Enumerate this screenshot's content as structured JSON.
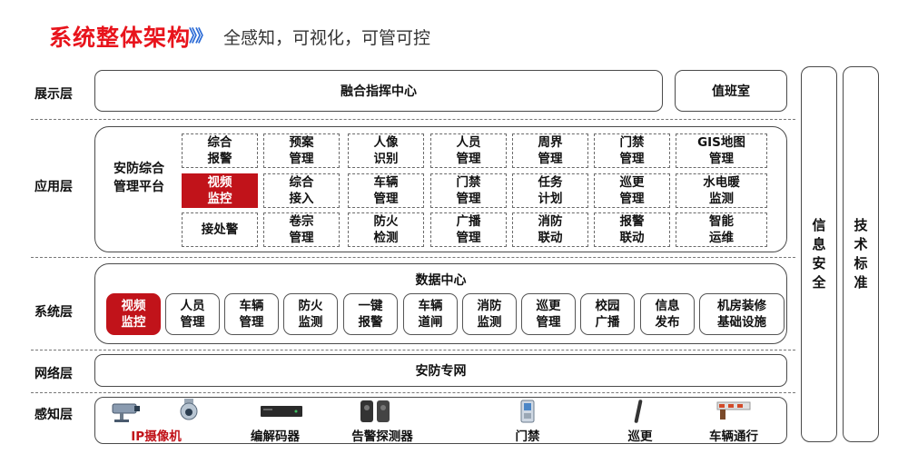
{
  "header": {
    "title": "系统整体架构",
    "arrows": "》》",
    "subtitle": "全感知，可视化，可管可控"
  },
  "layers": {
    "display": "展示层",
    "application": "应用层",
    "system": "系统层",
    "network": "网络层",
    "perception": "感知层"
  },
  "display_layer": {
    "main": "融合指挥中心",
    "duty": "值班室"
  },
  "application_layer": {
    "platform": "安防综合\n管理平台",
    "cells": [
      [
        "综合\n报警",
        "预案\n管理",
        "人像\n识别",
        "人员\n管理",
        "周界\n管理",
        "门禁\n管理",
        "GIS地图\n管理"
      ],
      [
        "视频\n监控",
        "综合\n接入",
        "车辆\n管理",
        "门禁\n管理",
        "任务\n计划",
        "巡更\n管理",
        "水电暖\n监测"
      ],
      [
        "接处警",
        "卷宗\n管理",
        "防火\n检测",
        "广播\n管理",
        "消防\n联动",
        "报警\n联动",
        "智能\n运维"
      ]
    ]
  },
  "system_layer": {
    "title": "数据中心",
    "chips": [
      "视频\n监控",
      "人员\n管理",
      "车辆\n管理",
      "防火\n监测",
      "一键\n报警",
      "车辆\n道闸",
      "消防\n监测",
      "巡更\n管理",
      "校园\n广播",
      "信息\n发布",
      "机房装修\n基础设施"
    ]
  },
  "network_layer": {
    "label": "安防专网"
  },
  "perception_layer": {
    "devices": [
      {
        "label": "IP摄像机",
        "icon": "ip-camera-icon"
      },
      {
        "label": "编解码器",
        "icon": "codec-icon"
      },
      {
        "label": "告警探测器",
        "icon": "alarm-detector-icon"
      },
      {
        "label": "门禁",
        "icon": "access-control-icon"
      },
      {
        "label": "巡更",
        "icon": "patrol-icon"
      },
      {
        "label": "车辆通行",
        "icon": "vehicle-gate-icon"
      }
    ]
  },
  "side": {
    "security": "信息安全",
    "standard": "技术标准"
  },
  "colors": {
    "title": "#e8141c",
    "highlight": "#c1131a",
    "arrows": "#2b6bd6"
  }
}
